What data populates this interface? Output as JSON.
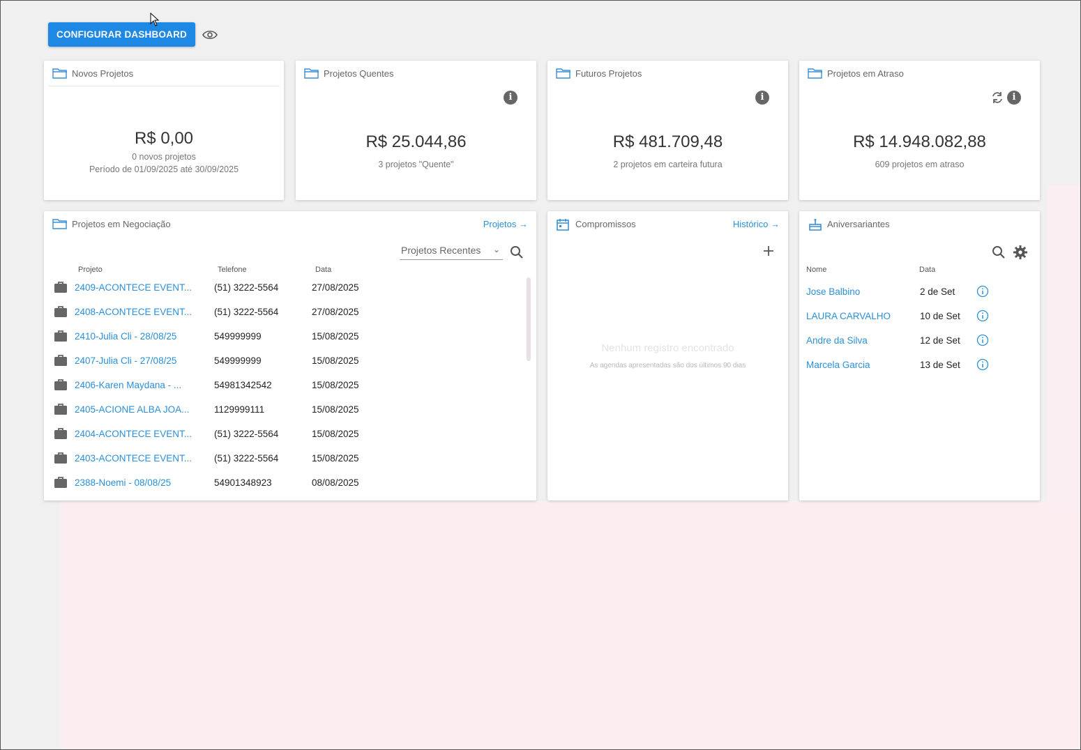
{
  "toolbar": {
    "config_label": "CONFIGURAR DASHBOARD",
    "eye_icon": "eye-icon"
  },
  "cards": {
    "novos": {
      "title": "Novos Projetos",
      "value": "R$ 0,00",
      "sub1": "0 novos projetos",
      "sub2": "Período de 01/09/2025 até 30/09/2025"
    },
    "quentes": {
      "title": "Projetos Quentes",
      "value": "R$ 25.044,86",
      "sub1": "3 projetos \"Quente\""
    },
    "futuros": {
      "title": "Futuros Projetos",
      "value": "R$ 481.709,48",
      "sub1": "2 projetos em carteira futura"
    },
    "atraso": {
      "title": "Projetos em Atraso",
      "value": "R$ 14.948.082,88",
      "sub1": "609 projetos em atraso"
    }
  },
  "negociacao": {
    "title": "Projetos em Negociação",
    "link": "Projetos →",
    "filter": "Projetos Recentes",
    "headers": {
      "projeto": "Projeto",
      "telefone": "Telefone",
      "data": "Data"
    },
    "rows": [
      {
        "projeto": "2409-ACONTECE EVENT...",
        "telefone": "(51) 3222-5564",
        "data": "27/08/2025"
      },
      {
        "projeto": "2408-ACONTECE EVENT...",
        "telefone": "(51) 3222-5564",
        "data": "27/08/2025"
      },
      {
        "projeto": "2410-Julia Cli - 28/08/25",
        "telefone": "549999999",
        "data": "15/08/2025"
      },
      {
        "projeto": "2407-Julia Cli - 27/08/25",
        "telefone": "549999999",
        "data": "15/08/2025"
      },
      {
        "projeto": "2406-Karen Maydana - ...",
        "telefone": "54981342542",
        "data": "15/08/2025"
      },
      {
        "projeto": "2405-ACIONE ALBA JOA...",
        "telefone": "1129999111",
        "data": "15/08/2025"
      },
      {
        "projeto": "2404-ACONTECE EVENT...",
        "telefone": "(51) 3222-5564",
        "data": "15/08/2025"
      },
      {
        "projeto": "2403-ACONTECE EVENT...",
        "telefone": "(51) 3222-5564",
        "data": "15/08/2025"
      },
      {
        "projeto": "2388-Noemi - 08/08/25",
        "telefone": "54901348923",
        "data": "08/08/2025"
      }
    ]
  },
  "compromissos": {
    "title": "Compromissos",
    "link": "Histórico →",
    "empty_title": "Nenhum registro encontrado",
    "empty_note": "As agendas apresentadas são dos últimos 90 dias"
  },
  "aniversariantes": {
    "title": "Aniversariantes",
    "headers": {
      "nome": "Nome",
      "data": "Data"
    },
    "rows": [
      {
        "nome": "Jose Balbino",
        "data": "2 de Set"
      },
      {
        "nome": "LAURA CARVALHO",
        "data": "10 de Set"
      },
      {
        "nome": "Andre da Silva",
        "data": "12 de Set"
      },
      {
        "nome": "Marcela Garcia",
        "data": "13 de Set"
      }
    ]
  },
  "colors": {
    "accent": "#1e88e5",
    "link": "#2a8fd8"
  }
}
